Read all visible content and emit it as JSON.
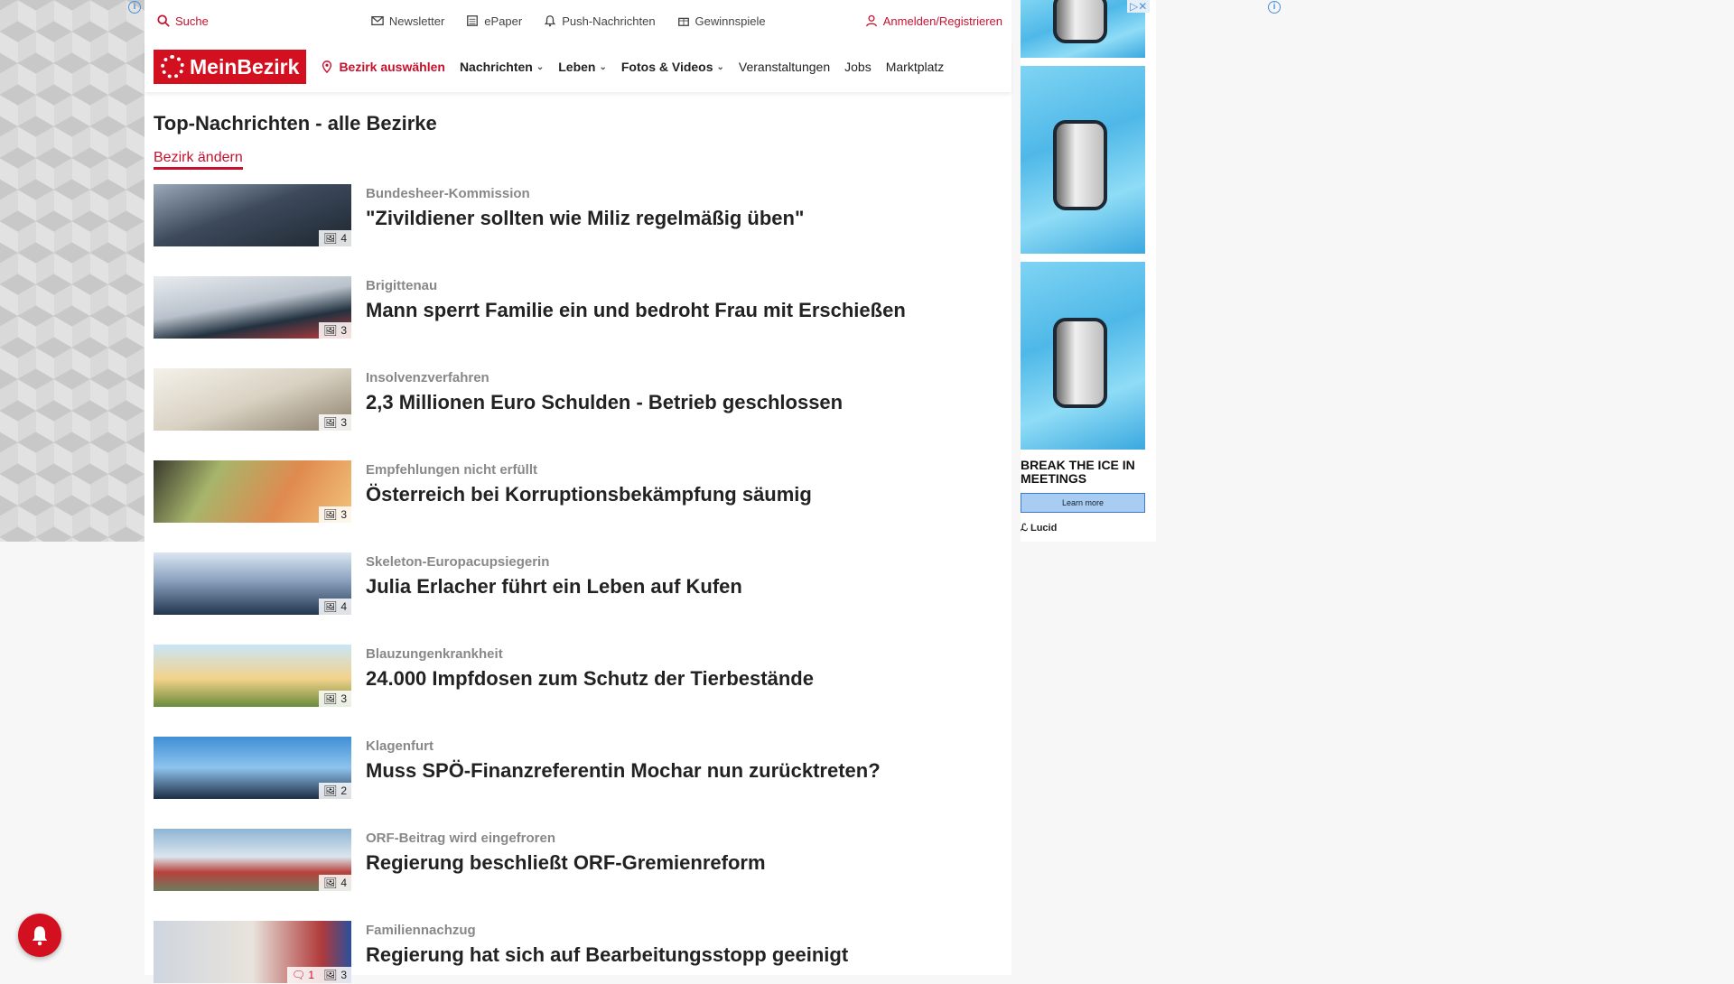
{
  "utility": {
    "search": "Suche",
    "newsletter": "Newsletter",
    "epaper": "ePaper",
    "push": "Push-Nachrichten",
    "gewinnspiele": "Gewinnspiele",
    "login": "Anmelden/Registrieren"
  },
  "nav": {
    "logo": "MeinBezirk",
    "bezirk": "Bezirk auswählen",
    "items": [
      "Nachrichten",
      "Leben",
      "Fotos & Videos",
      "Veranstaltungen",
      "Jobs",
      "Marktplatz"
    ]
  },
  "page": {
    "title": "Top-Nachrichten - alle Bezirke",
    "change_link": "Bezirk ändern"
  },
  "articles": [
    {
      "kicker": "Bundesheer-Kommission",
      "headline": "\"Zivildiener sollten wie Miliz regelmäßig üben\"",
      "images": "4",
      "comments": ""
    },
    {
      "kicker": "Brigittenau",
      "headline": "Mann sperrt Familie ein und bedroht Frau mit Erschießen",
      "images": "3",
      "comments": ""
    },
    {
      "kicker": "Insolvenzverfahren",
      "headline": "2,3 Millionen Euro Schulden - Betrieb geschlossen",
      "images": "3",
      "comments": ""
    },
    {
      "kicker": "Empfehlungen nicht erfüllt",
      "headline": "Österreich bei Korruptionsbekämpfung säumig",
      "images": "3",
      "comments": ""
    },
    {
      "kicker": "Skeleton-Europacupsiegerin",
      "headline": "Julia Erlacher führt ein Leben auf Kufen",
      "images": "4",
      "comments": ""
    },
    {
      "kicker": "Blauzungenkrankheit",
      "headline": "24.000 Impfdosen zum Schutz der Tierbestände",
      "images": "3",
      "comments": ""
    },
    {
      "kicker": "Klagenfurt",
      "headline": "Muss SPÖ-Finanzreferentin Mochar nun zurücktreten?",
      "images": "2",
      "comments": ""
    },
    {
      "kicker": "ORF-Beitrag wird eingefroren",
      "headline": "Regierung beschließt ORF-Gremienreform",
      "images": "4",
      "comments": ""
    },
    {
      "kicker": "Familiennachzug",
      "headline": "Regierung hat sich auf Bearbeitungsstopp geeinigt",
      "images": "3",
      "comments": "1"
    }
  ],
  "ad": {
    "headline": "BREAK THE ICE IN MEETINGS",
    "button": "Learn more",
    "brand": "Lucid"
  },
  "colors": {
    "brand_red": "#d3101f",
    "link_red": "#c8102e"
  }
}
